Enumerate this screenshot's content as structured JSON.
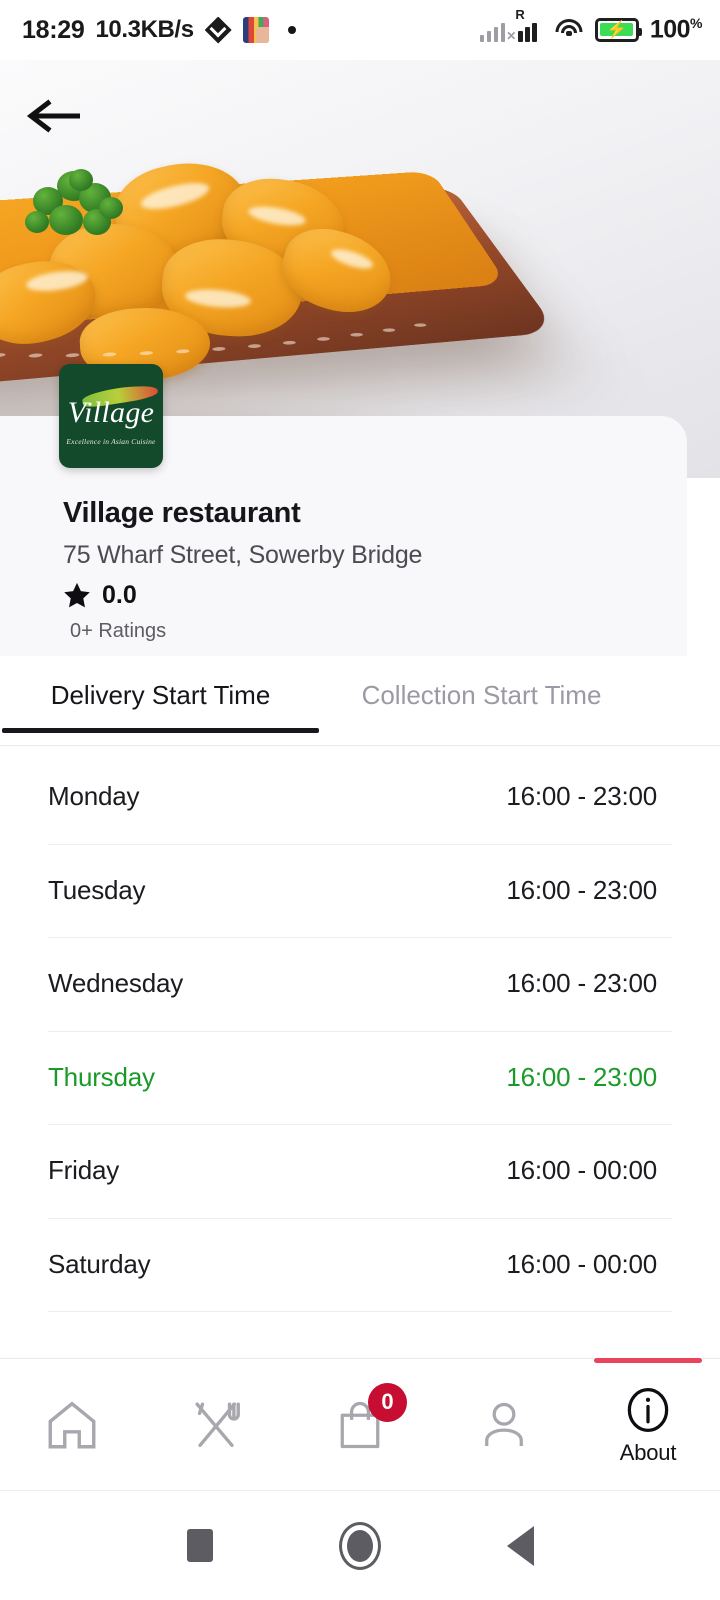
{
  "statusbar": {
    "time": "18:29",
    "network_speed": "10.3KB/s",
    "icons": [
      "download-manager-icon",
      "photo-gallery-icon",
      "notification-dot-icon"
    ],
    "signal_roaming_label": "R",
    "battery_percent": "100",
    "battery_percent_symbol": "%"
  },
  "hero": {
    "back_icon": "back-arrow-icon",
    "image_alt": "paneer curry in terracotta dish"
  },
  "restaurant": {
    "logo_word": "Village",
    "logo_tagline": "Excellence in Asian Cuisine",
    "name": "Village restaurant",
    "address": "75 Wharf Street, Sowerby Bridge",
    "rating_value": "0.0",
    "rating_star_icon": "star-icon",
    "ratings_count": "0+ Ratings"
  },
  "tabs": [
    {
      "label": "Delivery Start Time",
      "active": true
    },
    {
      "label": "Collection Start Time",
      "active": false
    }
  ],
  "schedule": {
    "rows": [
      {
        "day": "Monday",
        "time": "16:00 - 23:00",
        "today": false
      },
      {
        "day": "Tuesday",
        "time": "16:00 - 23:00",
        "today": false
      },
      {
        "day": "Wednesday",
        "time": "16:00 - 23:00",
        "today": false
      },
      {
        "day": "Thursday",
        "time": "16:00 - 23:00",
        "today": true
      },
      {
        "day": "Friday",
        "time": "16:00 - 00:00",
        "today": false
      },
      {
        "day": "Saturday",
        "time": "16:00 - 00:00",
        "today": false
      }
    ]
  },
  "bottom_nav": {
    "items": [
      {
        "icon": "home-icon",
        "label": "",
        "active": false,
        "badge": ""
      },
      {
        "icon": "cutlery-icon",
        "label": "",
        "active": false,
        "badge": ""
      },
      {
        "icon": "shopping-bag-icon",
        "label": "",
        "active": false,
        "badge": "0"
      },
      {
        "icon": "person-icon",
        "label": "",
        "active": false,
        "badge": ""
      },
      {
        "icon": "info-icon",
        "label": "About",
        "active": true,
        "badge": ""
      }
    ]
  },
  "system_nav": {
    "recents_icon": "square-recents-icon",
    "home_icon": "circle-home-icon",
    "back_icon": "triangle-back-icon"
  },
  "colors": {
    "today_green": "#1a9a28",
    "badge_red": "#c80d32",
    "active_tab_indicator": "#e8445c",
    "logo_green": "#124a2b",
    "battery_green": "#3ddc57"
  }
}
